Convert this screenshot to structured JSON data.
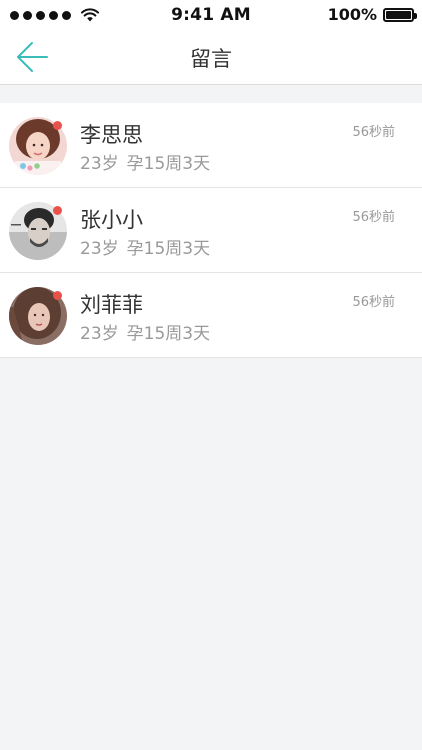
{
  "status_bar": {
    "time": "9:41 AM",
    "battery": "100%",
    "icons": [
      "signal-dots-icon",
      "wifi-icon",
      "battery-icon"
    ]
  },
  "nav": {
    "title": "留言",
    "back_icon": "arrow-left-icon",
    "accent_color": "#3bbcb9"
  },
  "messages": [
    {
      "name": "李思思",
      "age": "23岁",
      "pregnancy": "孕15周3天",
      "time": "56秒前",
      "unread": true
    },
    {
      "name": "张小小",
      "age": "23岁",
      "pregnancy": "孕15周3天",
      "time": "56秒前",
      "unread": true
    },
    {
      "name": "刘菲菲",
      "age": "23岁",
      "pregnancy": "孕15周3天",
      "time": "56秒前",
      "unread": true
    }
  ],
  "colors": {
    "unread_dot": "#e9524a",
    "background": "#f3f4f6",
    "primary_text": "#333333",
    "secondary_text": "#999999"
  }
}
